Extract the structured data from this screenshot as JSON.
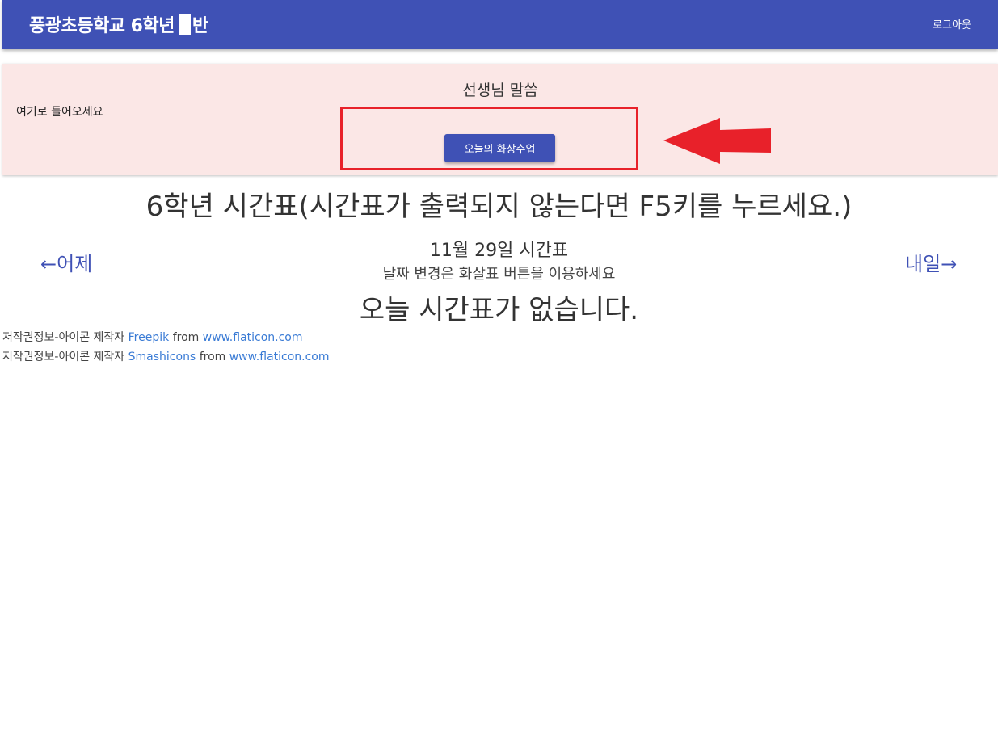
{
  "appbar": {
    "title_prefix": "풍광초등학교 6학년",
    "title_suffix": "반",
    "logout_label": "로그아웃"
  },
  "notice": {
    "left_text": "여기로 들어오세요",
    "title": "선생님 말씀",
    "button_label": "오늘의 화상수업"
  },
  "timetable": {
    "title": "6학년 시간표(시간표가 출력되지 않는다면 F5키를 누르세요.)",
    "prev_label": "←어제",
    "next_label": "내일→",
    "date_title": "11월 29일 시간표",
    "date_hint": "날짜 변경은 화살표 버튼을 이용하세요",
    "empty_message": "오늘 시간표가 없습니다."
  },
  "credits": [
    {
      "prefix": "저작권정보-아이콘 제작자",
      "author": "Freepik",
      "from": "from",
      "site": "www.flaticon.com"
    },
    {
      "prefix": "저작권정보-아이콘 제작자",
      "author": "Smashicons",
      "from": "from",
      "site": "www.flaticon.com"
    }
  ],
  "colors": {
    "primary": "#3f51b5",
    "notice_bg": "#fbe7e6",
    "annotation_red": "#e8212a",
    "link": "#3a7bd5"
  }
}
